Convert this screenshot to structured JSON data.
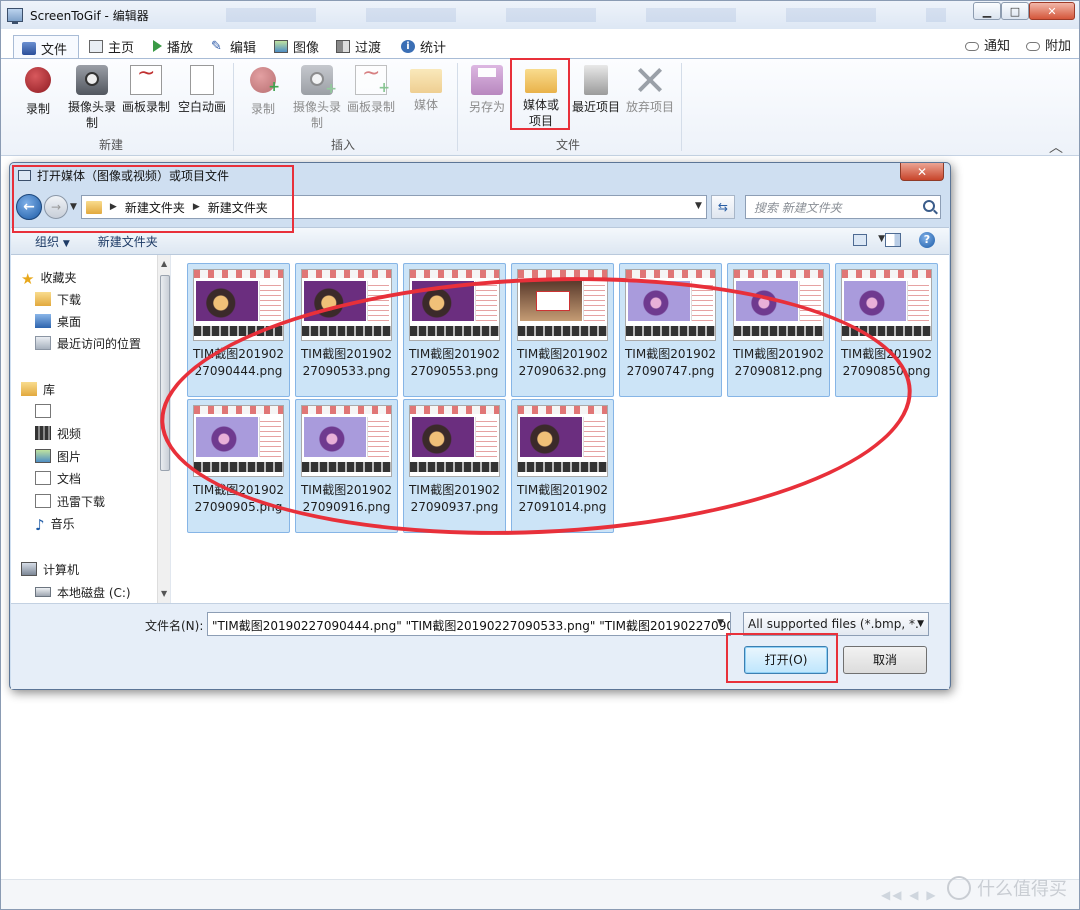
{
  "app": {
    "title": "ScreenToGif - 编辑器"
  },
  "ribbon_tabs": [
    {
      "label": "文件",
      "icon": "save-icon"
    },
    {
      "label": "主页",
      "icon": "home-icon"
    },
    {
      "label": "播放",
      "icon": "play-icon"
    },
    {
      "label": "编辑",
      "icon": "edit-icon"
    },
    {
      "label": "图像",
      "icon": "image-icon"
    },
    {
      "label": "过渡",
      "icon": "transition-icon"
    },
    {
      "label": "统计",
      "icon": "info-icon"
    }
  ],
  "ribbon_right": {
    "notify_label": "通知",
    "attach_label": "附加"
  },
  "ribbon_groups": {
    "new": {
      "label": "新建",
      "buttons": [
        {
          "label": "录制"
        },
        {
          "label": "摄像头录制"
        },
        {
          "label": "画板录制"
        },
        {
          "label": "空白动画"
        }
      ]
    },
    "insert": {
      "label": "插入",
      "buttons": [
        {
          "label": "录制"
        },
        {
          "label": "摄像头录制"
        },
        {
          "label": "画板录制"
        },
        {
          "label": "媒体"
        }
      ]
    },
    "file": {
      "label": "文件",
      "buttons": [
        {
          "label": "另存为"
        },
        {
          "label": "媒体或项目"
        },
        {
          "label": "最近项目"
        },
        {
          "label": "放弃项目"
        }
      ]
    }
  },
  "dialog": {
    "title": "打开媒体（图像或视频）或项目文件",
    "breadcrumbs": [
      "新建文件夹",
      "新建文件夹"
    ],
    "search_placeholder": "搜索 新建文件夹",
    "toolbar": {
      "organize_label": "组织",
      "new_folder_label": "新建文件夹"
    },
    "nav_pane": {
      "favorites": {
        "label": "收藏夹",
        "items": [
          "下载",
          "桌面",
          "最近访问的位置"
        ]
      },
      "library": {
        "label": "库",
        "items": [
          "",
          "视频",
          "图片",
          "文档",
          "迅雷下载",
          "音乐"
        ]
      },
      "computer": {
        "label": "计算机",
        "items": [
          "本地磁盘 (C:)"
        ]
      }
    },
    "files": [
      {
        "name": "TIM截图20190227090444.png",
        "thumb": "dark"
      },
      {
        "name": "TIM截图20190227090533.png",
        "thumb": "dark"
      },
      {
        "name": "TIM截图20190227090553.png",
        "thumb": "dark"
      },
      {
        "name": "TIM截图20190227090632.png",
        "thumb": "popup"
      },
      {
        "name": "TIM截图20190227090747.png",
        "thumb": "purple"
      },
      {
        "name": "TIM截图20190227090812.png",
        "thumb": "purple"
      },
      {
        "name": "TIM截图20190227090850.png",
        "thumb": "purple"
      },
      {
        "name": "TIM截图20190227090905.png",
        "thumb": "purple"
      },
      {
        "name": "TIM截图20190227090916.png",
        "thumb": "purple"
      },
      {
        "name": "TIM截图20190227090937.png",
        "thumb": "dark"
      },
      {
        "name": "TIM截图20190227091014.png",
        "thumb": "dark"
      }
    ],
    "filename_label": "文件名(N):",
    "filename_value": "\"TIM截图20190227090444.png\" \"TIM截图20190227090533.png\" \"TIM截图20190227090553",
    "filetype_value": "All supported files (*.bmp, *.",
    "open_button": "打开(O)",
    "cancel_button": "取消"
  },
  "watermark": {
    "text": "什么值得买"
  },
  "colors": {
    "annotation_red": "#e8303a",
    "selection_fill": "#cce4f7",
    "selection_border": "#86b5e6"
  }
}
